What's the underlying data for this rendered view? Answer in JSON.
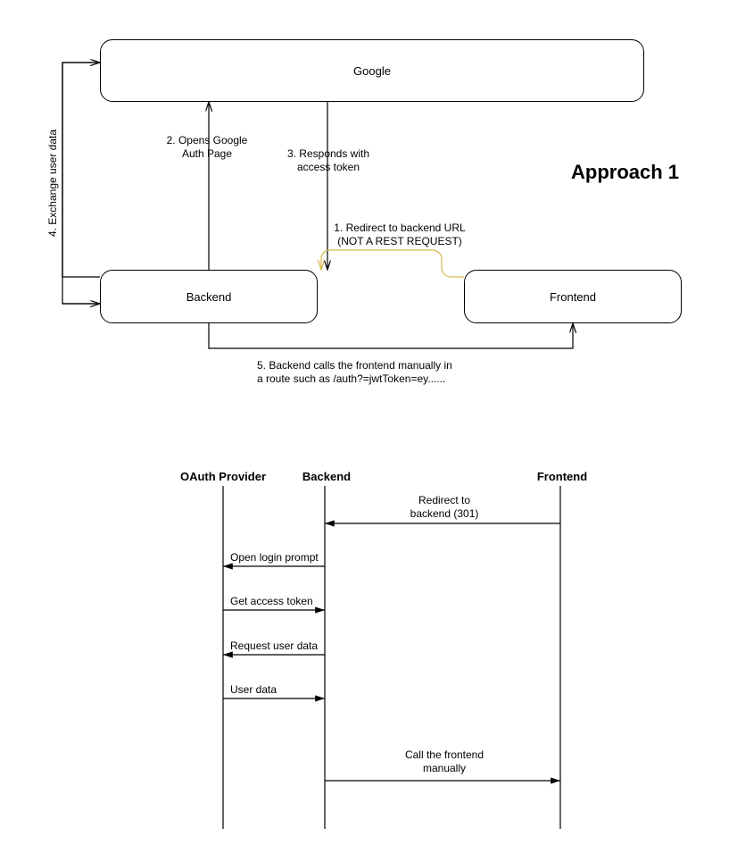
{
  "title": "Approach 1",
  "block_diagram": {
    "boxes": {
      "google": "Google",
      "backend": "Backend",
      "frontend": "Frontend"
    },
    "labels": {
      "step1_line1": "1. Redirect to backend URL",
      "step1_line2": "(NOT A REST REQUEST)",
      "step2_line1": "2. Opens Google",
      "step2_line2": "Auth Page",
      "step3_line1": "3. Responds with",
      "step3_line2": "access token",
      "step4": "4. Exchange user data",
      "step5_line1": "5. Backend calls the frontend manually in",
      "step5_line2": "a route such as /auth?=jwtToken=ey......"
    }
  },
  "sequence_diagram": {
    "lanes": {
      "oauth": "OAuth Provider",
      "backend": "Backend",
      "frontend": "Frontend"
    },
    "messages": {
      "m1_line1": "Redirect to",
      "m1_line2": "backend (301)",
      "m2": "Open login prompt",
      "m3": "Get access token",
      "m4": "Request user data",
      "m5": "User data",
      "m6_line1": "Call the frontend",
      "m6_line2": "manually"
    }
  }
}
